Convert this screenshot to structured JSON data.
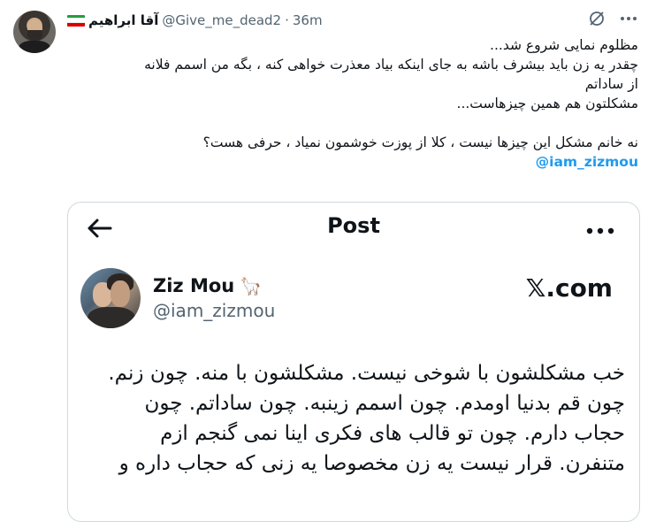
{
  "tweet": {
    "author_name": "آقا ابراهیم",
    "author_handle": "@Give_me_dead2",
    "separator": "·",
    "time": "36m",
    "lines": [
      "مظلوم نمایی شروع شد...",
      "چقدر یه زن باید بیشرف باشه به جای اینکه بیاد معذرت خواهی کنه ، بگه من اسمم فلانه",
      "از ساداتم",
      "مشکلتون هم همین چیزهاست..."
    ],
    "lines2": [
      "نه خانم مشکل این چیزها نیست ، کلا از پوزت خوشمون نمیاد ، حرفی هست؟"
    ],
    "mention": "@iam_zizmou"
  },
  "quoted": {
    "header_title": "Post",
    "author_name": "Ziz Mou",
    "author_emoji": "🦙",
    "author_handle": "@iam_zizmou",
    "brand": "𝕏.com",
    "lines": [
      "خب مشکلشون با شوخی نیست. مشکلشون با منه. چون زنم.",
      "چون قم بدنیا اومدم. چون اسمم زینبه. چون ساداتم. چون",
      "حجاب دارم. چون تو قالب های فکری اینا نمی گنجم ازم",
      "متنفرن. قرار نیست یه زن مخصوصا یه زنی که حجاب داره و"
    ]
  },
  "icons": {
    "grok": "grok-icon",
    "more": "more-icon",
    "back": "back-arrow-icon",
    "flag": "iran-flag-icon"
  },
  "colors": {
    "link": "#1d9bf0",
    "secondary": "#536471",
    "border": "#cfd9de"
  }
}
